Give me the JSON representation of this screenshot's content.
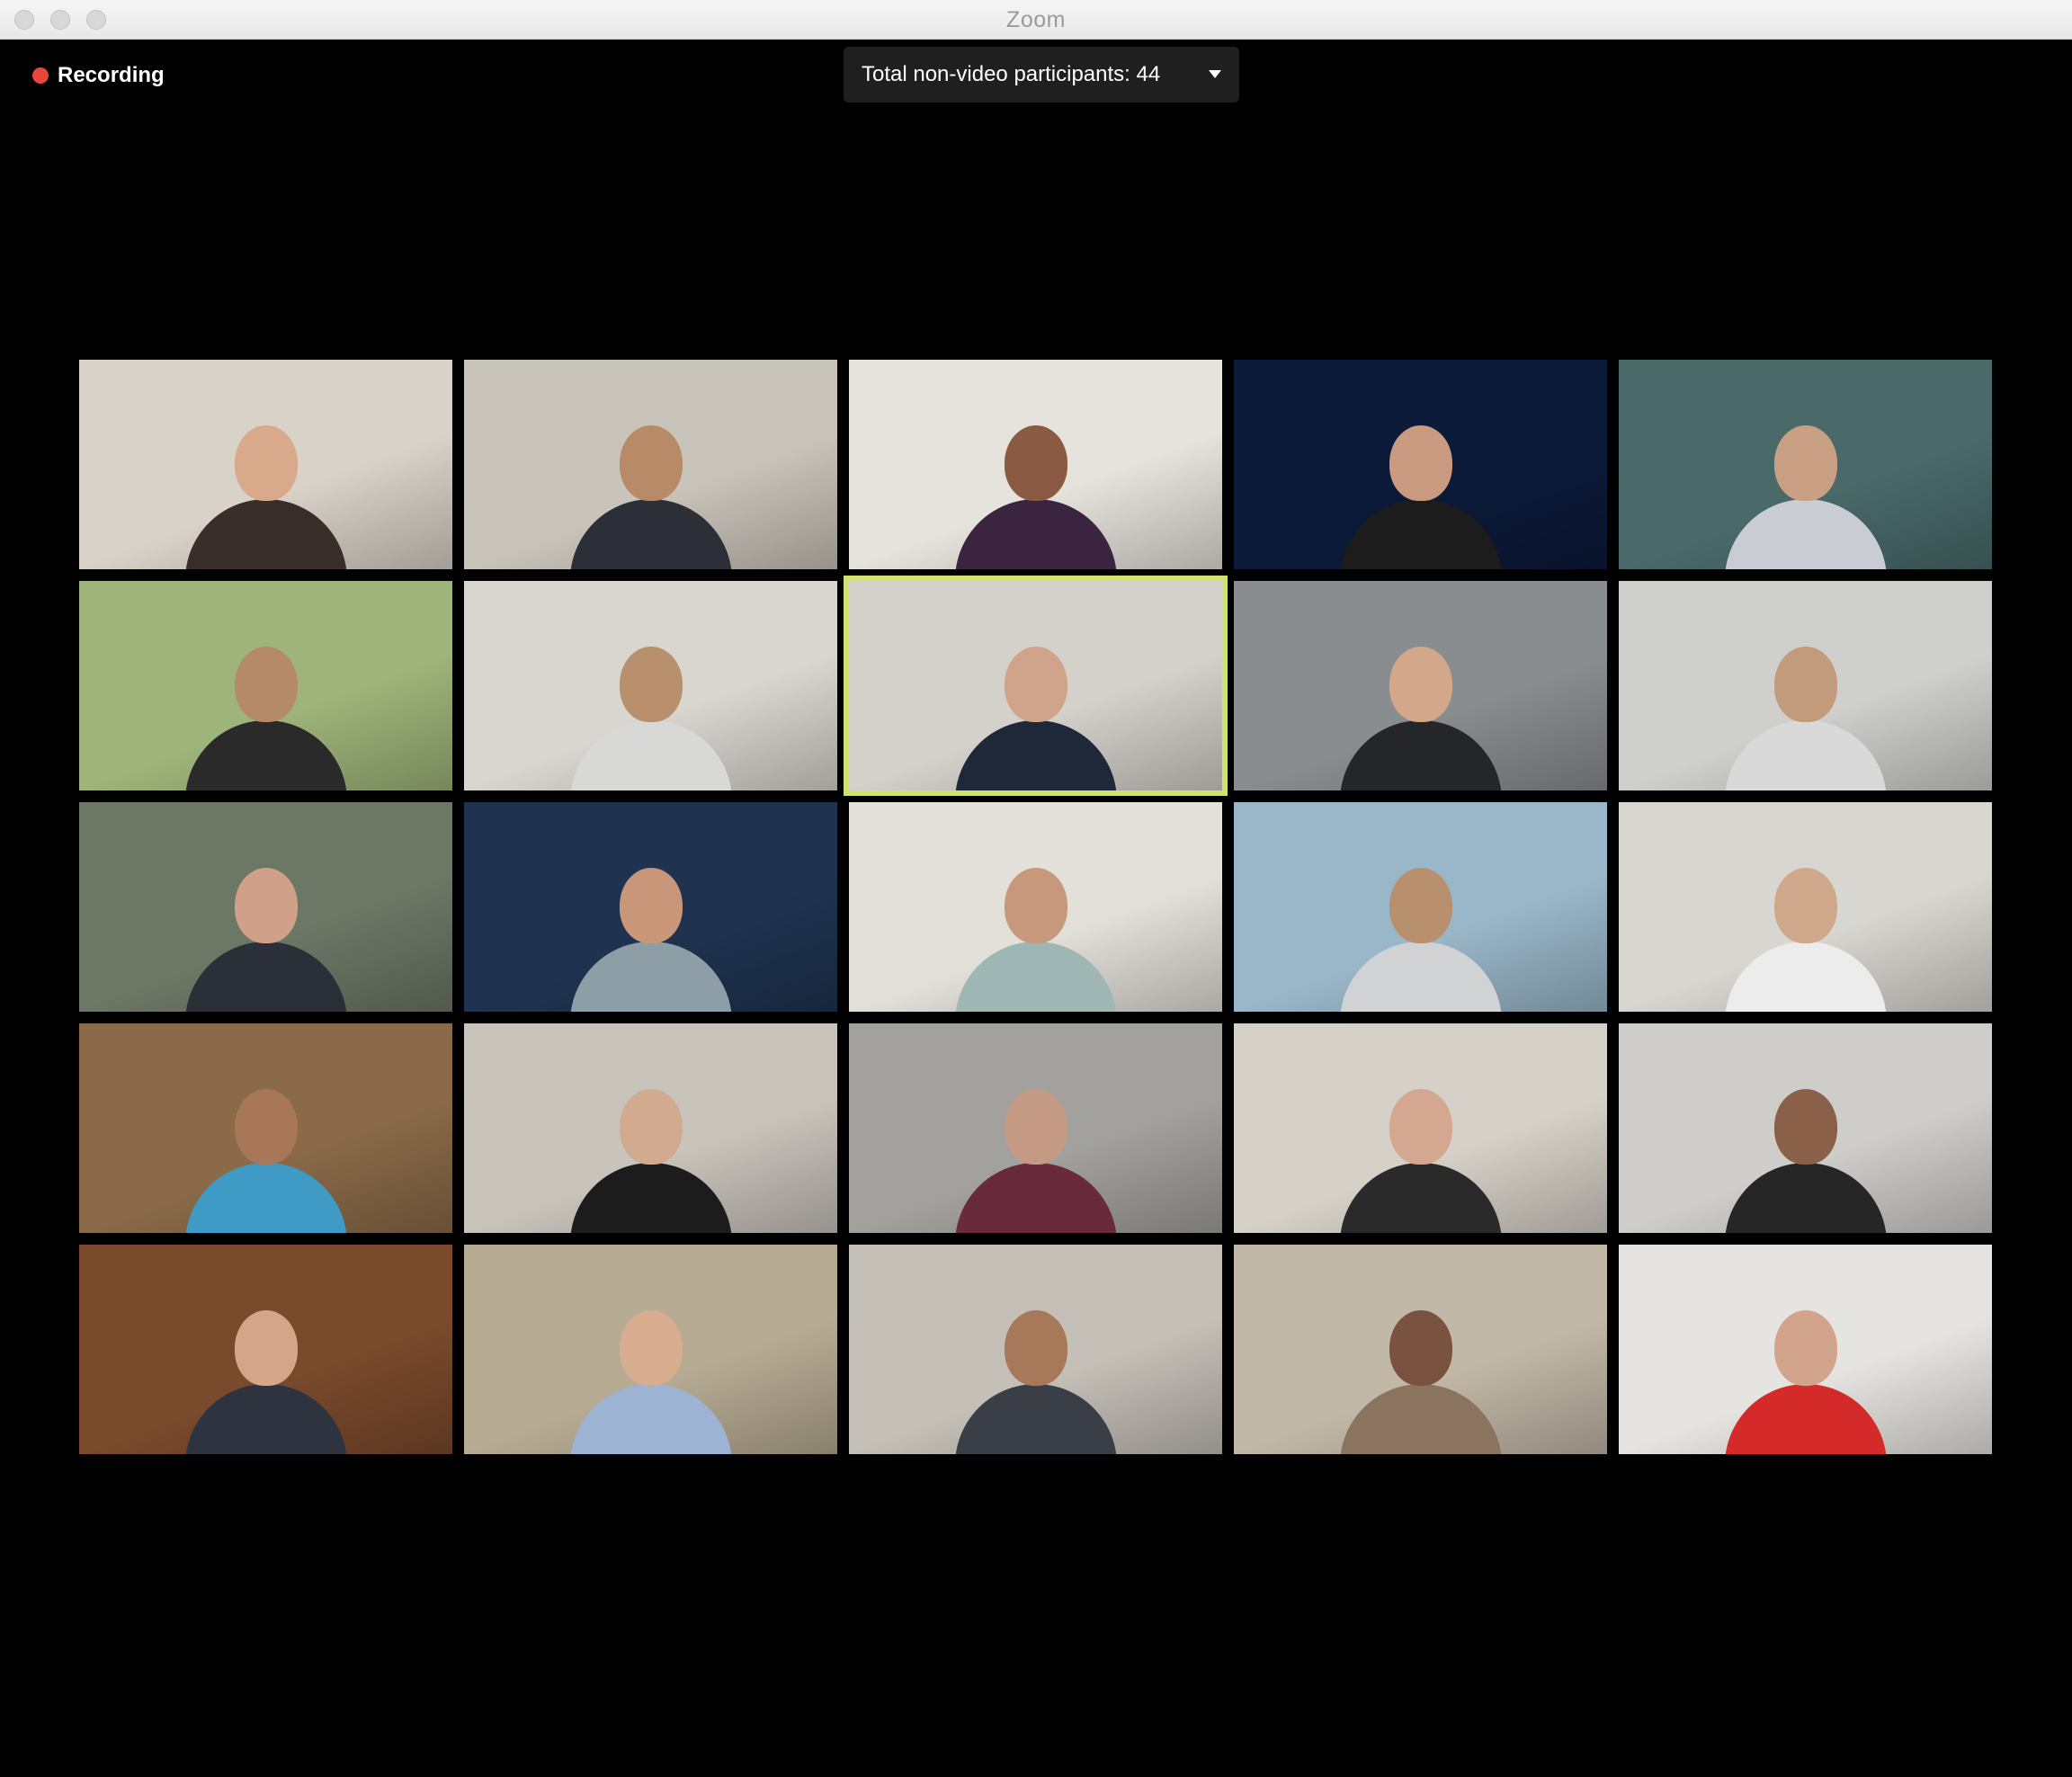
{
  "window": {
    "title": "Zoom"
  },
  "recording": {
    "label": "Recording"
  },
  "participants_banner": {
    "label": "Total non-video participants: 44"
  },
  "colors": {
    "active_speaker_border": "#cfe36e",
    "recording_dot": "#e8453c"
  },
  "video_tiles": [
    {
      "bg": "#d8d2c8",
      "skin": "#d8a98a",
      "shirt": "#3a2e2a"
    },
    {
      "bg": "#c9c4ba",
      "skin": "#b98a68",
      "shirt": "#2c2f38"
    },
    {
      "bg": "#e6e2dc",
      "skin": "#8a5a42",
      "shirt": "#3b2440"
    },
    {
      "bg": "#0c1a3a",
      "skin": "#c99a80",
      "shirt": "#1c1c1c"
    },
    {
      "bg": "#4a6a6a",
      "skin": "#caa084",
      "shirt": "#c9ccd2"
    },
    {
      "bg": "#9fb47a",
      "skin": "#b58a6a",
      "shirt": "#2a2a2a"
    },
    {
      "bg": "#d9d5cf",
      "skin": "#b8906e",
      "shirt": "#d8d8d6"
    },
    {
      "bg": "#d4d0ca",
      "skin": "#d0a48a",
      "shirt": "#1e2838"
    },
    {
      "bg": "#8a8d90",
      "skin": "#d3a88a",
      "shirt": "#24262a"
    },
    {
      "bg": "#cfcfcb",
      "skin": "#c29a7c",
      "shirt": "#d9d9d9"
    },
    {
      "bg": "#6d7766",
      "skin": "#d0a088",
      "shirt": "#2a2f38"
    },
    {
      "bg": "#1f3350",
      "skin": "#c9967a",
      "shirt": "#8d9ea6"
    },
    {
      "bg": "#e3e0da",
      "skin": "#c7987c",
      "shirt": "#9fb7b4"
    },
    {
      "bg": "#9ab7c9",
      "skin": "#b8906e",
      "shirt": "#d0d2d4"
    },
    {
      "bg": "#d8d6d0",
      "skin": "#cfa88c",
      "shirt": "#ececec"
    },
    {
      "bg": "#8a6a48",
      "skin": "#a8775a",
      "shirt": "#3f9ac6"
    },
    {
      "bg": "#c8c3bb",
      "skin": "#d2aa90",
      "shirt": "#1c1c1c"
    },
    {
      "bg": "#a3a19d",
      "skin": "#c49a84",
      "shirt": "#6a2a3e"
    },
    {
      "bg": "#d6d1c8",
      "skin": "#d4a890",
      "shirt": "#2a2a2a"
    },
    {
      "bg": "#cfcdca",
      "skin": "#8a6048",
      "shirt": "#262626"
    },
    {
      "bg": "#7a4a2c",
      "skin": "#d3a68a",
      "shirt": "#2e3340"
    },
    {
      "bg": "#b7ab94",
      "skin": "#d8ac8e",
      "shirt": "#9db3d4"
    },
    {
      "bg": "#c4bfb7",
      "skin": "#a8785a",
      "shirt": "#3a3e46"
    },
    {
      "bg": "#c2b8a8",
      "skin": "#7a5240",
      "shirt": "#8a7460"
    },
    {
      "bg": "#e6e4e0",
      "skin": "#d2a48c",
      "shirt": "#d42a2a"
    }
  ]
}
